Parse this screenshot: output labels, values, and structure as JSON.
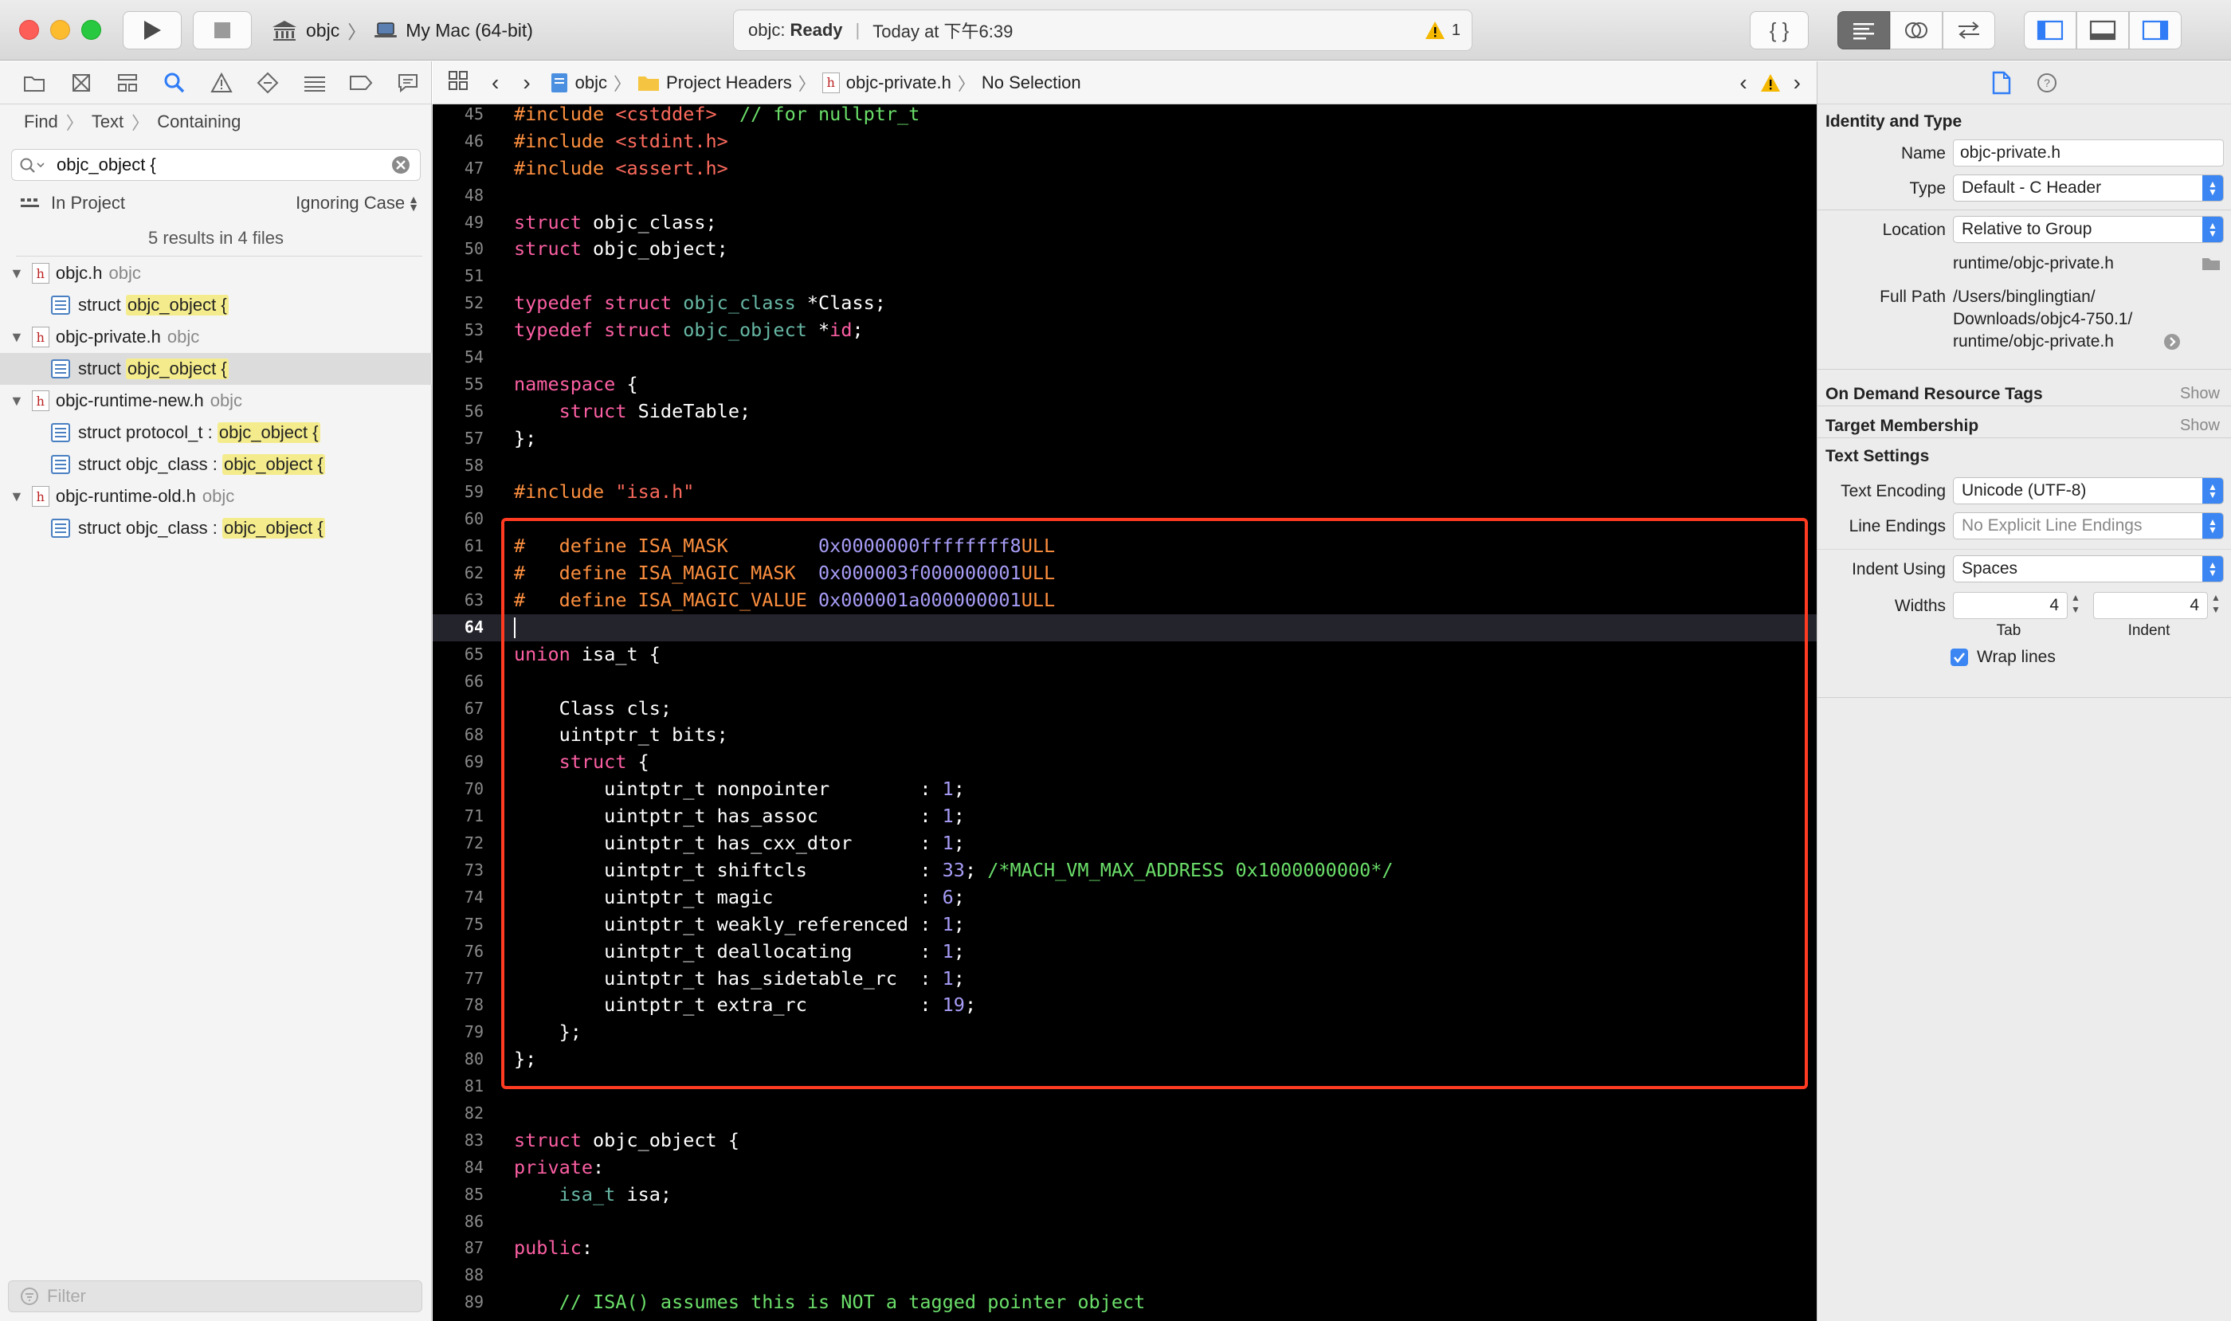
{
  "toolbar": {
    "scheme_name": "objc",
    "destination": "My Mac (64-bit)",
    "status_project": "objc:",
    "status_state": "Ready",
    "status_time": "Today at 下午6:39",
    "warning_count": "1"
  },
  "navigator": {
    "find_mode": "Find",
    "find_type": "Text",
    "find_match": "Containing",
    "search_query": "objc_object {",
    "scope": "In Project",
    "case_mode": "Ignoring Case",
    "summary": "5 results in 4 files",
    "files": [
      {
        "name": "objc.h",
        "group": "objc",
        "results": [
          {
            "prefix": "struct ",
            "match": "objc_object {"
          }
        ]
      },
      {
        "name": "objc-private.h",
        "group": "objc",
        "results": [
          {
            "prefix": "struct ",
            "match": "objc_object {"
          }
        ]
      },
      {
        "name": "objc-runtime-new.h",
        "group": "objc",
        "results": [
          {
            "prefix": "struct protocol_t : ",
            "match": "objc_object {"
          },
          {
            "prefix": "struct objc_class : ",
            "match": "objc_object {"
          }
        ]
      },
      {
        "name": "objc-runtime-old.h",
        "group": "objc",
        "results": [
          {
            "prefix": "struct objc_class : ",
            "match": "objc_object {"
          }
        ]
      }
    ],
    "filter_placeholder": "Filter"
  },
  "jumpbar": {
    "crumbs": [
      "objc",
      "Project Headers",
      "objc-private.h",
      "No Selection"
    ]
  },
  "editor": {
    "first_line": 45,
    "current_line": 64,
    "lines": [
      [
        [
          "pp",
          "#include "
        ],
        [
          "str",
          "<cstddef>"
        ],
        [
          "cm",
          "  // for nullptr_t"
        ]
      ],
      [
        [
          "pp",
          "#include "
        ],
        [
          "str",
          "<stdint.h>"
        ]
      ],
      [
        [
          "pp",
          "#include "
        ],
        [
          "str",
          "<assert.h>"
        ]
      ],
      [],
      [
        [
          "kw",
          "struct"
        ],
        [
          "",
          "objc_class;"
        ]
      ],
      [
        [
          "kw",
          "struct"
        ],
        [
          "",
          "objc_object;"
        ]
      ],
      [],
      [
        [
          "kw",
          "typedef struct "
        ],
        [
          "ty",
          "objc_class"
        ],
        [
          "",
          " *Class;"
        ]
      ],
      [
        [
          "kw",
          "typedef struct "
        ],
        [
          "ty",
          "objc_object"
        ],
        [
          "",
          " *"
        ],
        [
          "kw",
          "id"
        ],
        [
          "",
          ";"
        ]
      ],
      [],
      [
        [
          "kw",
          "namespace"
        ],
        [
          "",
          " {"
        ]
      ],
      [
        [
          "",
          "    "
        ],
        [
          "kw",
          "struct"
        ],
        [
          "",
          " SideTable;"
        ]
      ],
      [
        [
          "",
          "};"
        ]
      ],
      [],
      [
        [
          "pp",
          "#include "
        ],
        [
          "str",
          "\"isa.h\""
        ]
      ],
      [],
      [
        [
          "pp",
          "#   define ISA_MASK        "
        ],
        [
          "num",
          "0x0000000ffffffff8"
        ],
        [
          "pp",
          "ULL"
        ]
      ],
      [
        [
          "pp",
          "#   define ISA_MAGIC_MASK  "
        ],
        [
          "num",
          "0x000003f000000001"
        ],
        [
          "pp",
          "ULL"
        ]
      ],
      [
        [
          "pp",
          "#   define ISA_MAGIC_VALUE "
        ],
        [
          "num",
          "0x000001a000000001"
        ],
        [
          "pp",
          "ULL"
        ]
      ],
      [],
      [
        [
          "kw",
          "union"
        ],
        [
          "",
          " isa_t {"
        ]
      ],
      [],
      [
        [
          "",
          "    Class cls;"
        ]
      ],
      [
        [
          "",
          "    uintptr_t bits;"
        ]
      ],
      [
        [
          "",
          "    "
        ],
        [
          "kw",
          "struct"
        ],
        [
          "",
          " {"
        ]
      ],
      [
        [
          "",
          "        uintptr_t nonpointer        : "
        ],
        [
          "num",
          "1"
        ],
        [
          "",
          ";"
        ]
      ],
      [
        [
          "",
          "        uintptr_t has_assoc         : "
        ],
        [
          "num",
          "1"
        ],
        [
          "",
          ";"
        ]
      ],
      [
        [
          "",
          "        uintptr_t has_cxx_dtor      : "
        ],
        [
          "num",
          "1"
        ],
        [
          "",
          ";"
        ]
      ],
      [
        [
          "",
          "        uintptr_t shiftcls          : "
        ],
        [
          "num",
          "33"
        ],
        [
          "",
          "; "
        ],
        [
          "cm",
          "/*MACH_VM_MAX_ADDRESS 0x1000000000*/"
        ]
      ],
      [
        [
          "",
          "        uintptr_t magic             : "
        ],
        [
          "num",
          "6"
        ],
        [
          "",
          ";"
        ]
      ],
      [
        [
          "",
          "        uintptr_t weakly_referenced : "
        ],
        [
          "num",
          "1"
        ],
        [
          "",
          ";"
        ]
      ],
      [
        [
          "",
          "        uintptr_t deallocating      : "
        ],
        [
          "num",
          "1"
        ],
        [
          "",
          ";"
        ]
      ],
      [
        [
          "",
          "        uintptr_t has_sidetable_rc  : "
        ],
        [
          "num",
          "1"
        ],
        [
          "",
          ";"
        ]
      ],
      [
        [
          "",
          "        uintptr_t extra_rc          : "
        ],
        [
          "num",
          "19"
        ],
        [
          "",
          ";"
        ]
      ],
      [
        [
          "",
          "    };"
        ]
      ],
      [
        [
          "",
          "};"
        ]
      ],
      [],
      [],
      [
        [
          "kw",
          "struct"
        ],
        [
          "",
          " objc_object {"
        ]
      ],
      [
        [
          "kw",
          "private"
        ],
        [
          "",
          ":"
        ]
      ],
      [
        [
          "",
          "    "
        ],
        [
          "ty",
          "isa_t"
        ],
        [
          "",
          " isa;"
        ]
      ],
      [],
      [
        [
          "kw",
          "public"
        ],
        [
          "",
          ":"
        ]
      ],
      [],
      [
        [
          "cm",
          "    // ISA() assumes this is NOT a tagged pointer object"
        ]
      ]
    ]
  },
  "inspector": {
    "identity_title": "Identity and Type",
    "name_label": "Name",
    "name_value": "objc-private.h",
    "type_label": "Type",
    "type_value": "Default - C Header",
    "location_label": "Location",
    "location_value": "Relative to Group",
    "location_path": "runtime/objc-private.h",
    "fullpath_label": "Full Path",
    "fullpath_lines": [
      "/Users/binglingtian/",
      "Downloads/objc4-750.1/",
      "runtime/objc-private.h"
    ],
    "odr_title": "On Demand Resource Tags",
    "odr_action": "Show",
    "target_title": "Target Membership",
    "target_action": "Show",
    "text_settings_title": "Text Settings",
    "encoding_label": "Text Encoding",
    "encoding_value": "Unicode (UTF-8)",
    "line_endings_label": "Line Endings",
    "line_endings_value": "No Explicit Line Endings",
    "indent_label": "Indent Using",
    "indent_value": "Spaces",
    "widths_label": "Widths",
    "tab_width": "4",
    "indent_width": "4",
    "tab_caption": "Tab",
    "indent_caption": "Indent",
    "wrap_label": "Wrap lines",
    "wrap_checked": true
  },
  "colors": {
    "highlight_box": "#ff3b22",
    "accent": "#3b86f2",
    "warning": "#f5b800"
  }
}
